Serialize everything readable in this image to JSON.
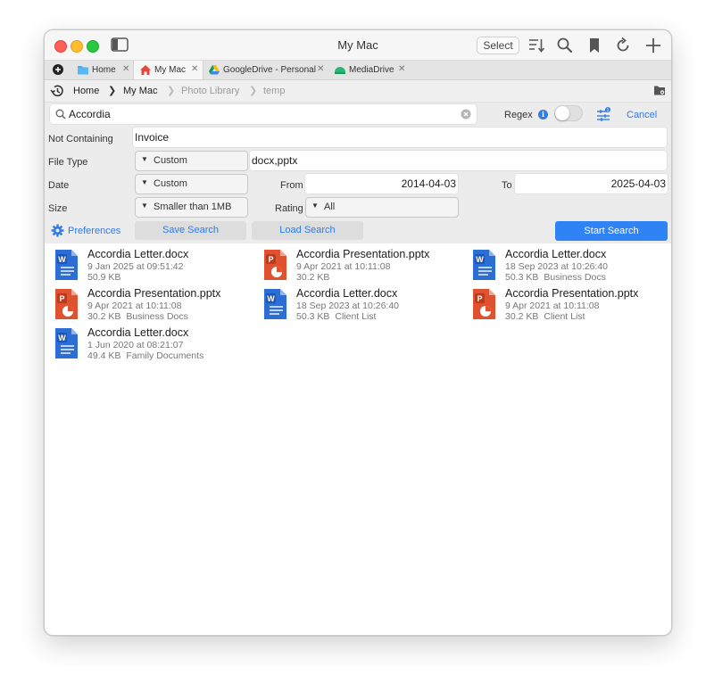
{
  "window": {
    "title": "My Mac"
  },
  "toolbar": {
    "select_label": "Select"
  },
  "tabs": [
    {
      "label": "Home",
      "icon": "folder-icon"
    },
    {
      "label": "My Mac",
      "icon": "house-icon"
    },
    {
      "label": "GoogleDrive - Personal",
      "icon": "google-drive-icon"
    },
    {
      "label": "MediaDrive",
      "icon": "drive-icon"
    }
  ],
  "breadcrumb": [
    "Home",
    "My Mac",
    "Photo Library",
    "temp"
  ],
  "search": {
    "query": "Accordia",
    "regex_label": "Regex",
    "regex_enabled": false,
    "cancel_label": "Cancel",
    "not_containing_label": "Not Containing",
    "not_containing_value": "Invoice",
    "file_type_label": "File Type",
    "file_type_mode": "Custom",
    "file_type_value": "docx,pptx",
    "date_label": "Date",
    "date_mode": "Custom",
    "from_label": "From",
    "from_value": "2014-04-03",
    "to_label": "To",
    "to_value": "2025-04-03",
    "size_label": "Size",
    "size_value": "Smaller than 1MB",
    "rating_label": "Rating",
    "rating_value": "All",
    "preferences_label": "Preferences",
    "save_label": "Save Search",
    "load_label": "Load Search",
    "start_label": "Start Search"
  },
  "colors": {
    "accent": "#2f83f4",
    "word": "#2b6fd6",
    "powerpoint": "#e0512f"
  },
  "results": [
    {
      "name": "Accordia Letter.docx",
      "date": "9 Jan 2025 at 09:51:42",
      "size": "50.9 KB",
      "folder": "",
      "type": "word"
    },
    {
      "name": "Accordia Presentation.pptx",
      "date": "9 Apr 2021 at 10:11:08",
      "size": "30.2 KB",
      "folder": "",
      "type": "powerpoint"
    },
    {
      "name": "Accordia Letter.docx",
      "date": "18 Sep 2023 at 10:26:40",
      "size": "50.3 KB",
      "folder": "Business Docs",
      "type": "word"
    },
    {
      "name": "Accordia Presentation.pptx",
      "date": "9 Apr 2021 at 10:11:08",
      "size": "30.2 KB",
      "folder": "Business Docs",
      "type": "powerpoint"
    },
    {
      "name": "Accordia Letter.docx",
      "date": "18 Sep 2023 at 10:26:40",
      "size": "50.3 KB",
      "folder": "Client List",
      "type": "word"
    },
    {
      "name": "Accordia Presentation.pptx",
      "date": "9 Apr 2021 at 10:11:08",
      "size": "30.2 KB",
      "folder": "Client List",
      "type": "powerpoint"
    },
    {
      "name": "Accordia Letter.docx",
      "date": "1 Jun 2020 at 08:21:07",
      "size": "49.4 KB",
      "folder": "Family Documents",
      "type": "word"
    }
  ]
}
